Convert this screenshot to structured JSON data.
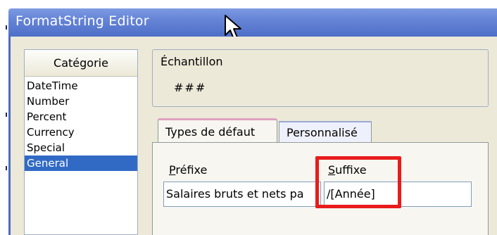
{
  "window": {
    "title": "FormatString Editor"
  },
  "category": {
    "header": "Catégorie",
    "items": [
      "DateTime",
      "Number",
      "Percent",
      "Currency",
      "Special",
      "General"
    ],
    "selected": "General"
  },
  "sample": {
    "label": "Échantillon",
    "value": "###"
  },
  "tabs": [
    {
      "label": "Types de défaut",
      "active": true
    },
    {
      "label": "Personnalisé",
      "active": false
    }
  ],
  "prefix": {
    "label_underlined": "P",
    "label_rest": "réfixe",
    "value": "Salaires bruts et nets pa"
  },
  "suffix": {
    "label_underlined": "S",
    "label_rest": "uffixe",
    "value": "/[Année]"
  },
  "colors": {
    "titlebar": "#6584d6",
    "selection": "#316ac5",
    "highlight": "#e81c1c",
    "dialog": "#ece9d8"
  },
  "icons": {
    "cursor": "mouse-pointer-icon"
  }
}
